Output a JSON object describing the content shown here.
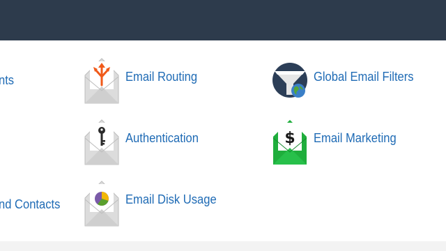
{
  "left_column": {
    "item_1_partial": "nts",
    "item_3_partial": "nd Contacts"
  },
  "center_column": [
    {
      "label": "Email Routing",
      "icon": "routing-arrow-envelope-icon"
    },
    {
      "label": "Authentication",
      "icon": "key-envelope-icon"
    },
    {
      "label": "Email Disk Usage",
      "icon": "pie-chart-envelope-icon"
    }
  ],
  "right_column": [
    {
      "label": "Global Email Filters",
      "icon": "funnel-globe-icon"
    },
    {
      "label": "Email Marketing",
      "icon": "dollar-envelope-icon"
    }
  ],
  "colors": {
    "header": "#2d3b4c",
    "link": "#1f6bb5",
    "envelope": "#d8d8d8",
    "routing_accent": "#f05a1a",
    "marketing_green": "#1fae3c",
    "filter_circle": "#2c3e57"
  }
}
